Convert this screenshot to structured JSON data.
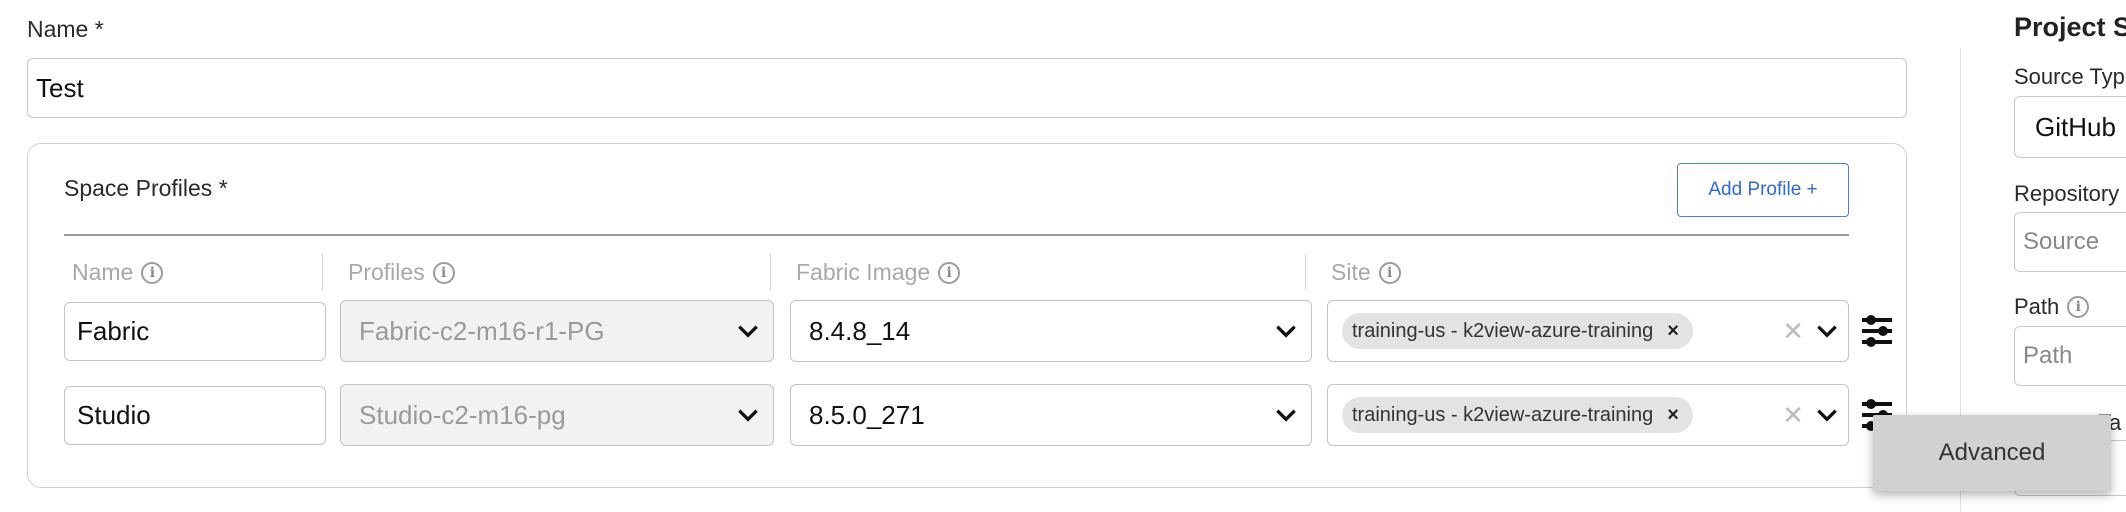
{
  "form": {
    "name_label": "Name *",
    "name_value": "Test"
  },
  "space_profiles": {
    "title": "Space Profiles *",
    "add_button": "Add Profile +",
    "columns": {
      "name": "Name",
      "profiles": "Profiles",
      "fabric_image": "Fabric Image",
      "site": "Site"
    },
    "rows": [
      {
        "name": "Fabric",
        "profile": "Fabric-c2-m16-r1-PG",
        "fabric_image": "8.4.8_14",
        "site_chip": "training-us - k2view-azure-training",
        "chip_remove": "×",
        "clear": "✕"
      },
      {
        "name": "Studio",
        "profile": "Studio-c2-m16-pg",
        "fabric_image": "8.5.0_271",
        "site_chip": "training-us - k2view-azure-training",
        "chip_remove": "×",
        "clear": "✕"
      }
    ]
  },
  "tooltip": {
    "advanced": "Advanced"
  },
  "project_source": {
    "title": "Project Sc",
    "source_type_label": "Source Typ",
    "source_type_value": "GitHub",
    "repository_label": "Repository",
    "repository_placeholder": "Source",
    "path_label": "Path",
    "path_placeholder": "Path",
    "cut_label": "Ta",
    "cut_value": "/"
  },
  "colors": {
    "accent": "#2f6ad8",
    "border": "#c8c8c8",
    "disabled_bg": "#f2f2f2",
    "chip_bg": "#e3e3e3",
    "tooltip_bg": "#d1d1d1"
  }
}
